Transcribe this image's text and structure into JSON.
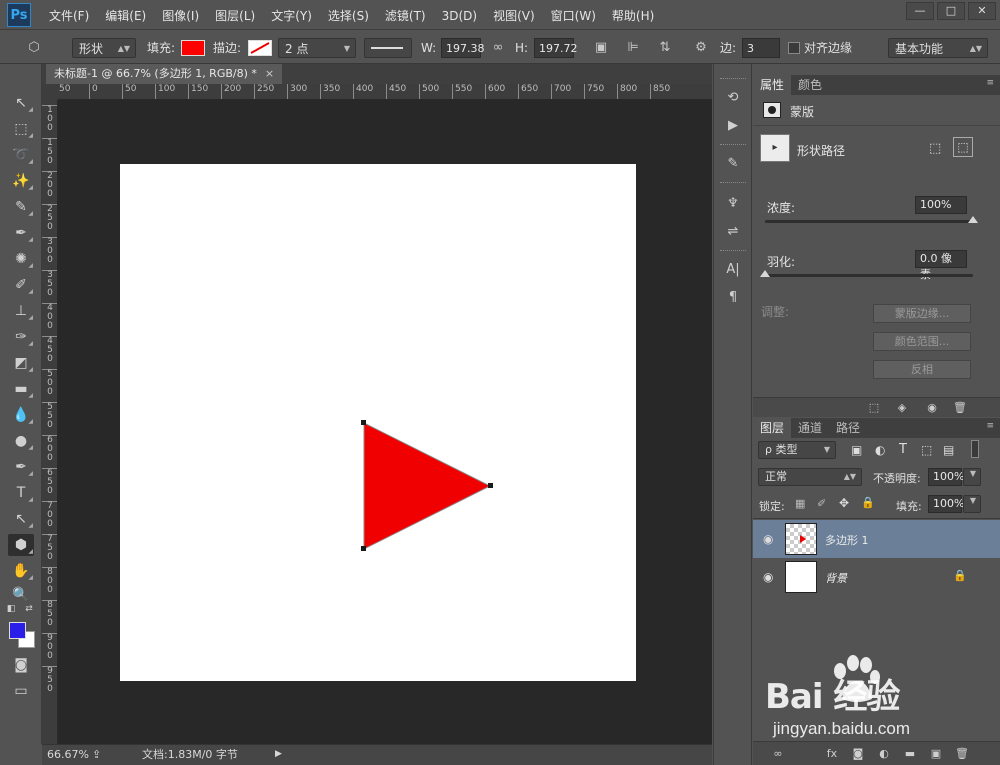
{
  "app": {
    "logo": "Ps"
  },
  "menu": [
    "文件(F)",
    "编辑(E)",
    "图像(I)",
    "图层(L)",
    "文字(Y)",
    "选择(S)",
    "滤镜(T)",
    "3D(D)",
    "视图(V)",
    "窗口(W)",
    "帮助(H)"
  ],
  "window_controls": {
    "minimize": "—",
    "maximize": "□",
    "close": "✕"
  },
  "options": {
    "mode": "形状",
    "fill_label": "填充:",
    "stroke_label": "描边:",
    "stroke_width": "2 点",
    "w_label": "W:",
    "w_value": "197.38",
    "h_label": "H:",
    "h_value": "197.72",
    "sides_label": "边:",
    "sides_value": "3",
    "align_edges": "对齐边缘",
    "workspace": "基本功能",
    "fill_color": "#ff0000"
  },
  "document": {
    "tab_title": "未标题-1 @ 66.7% (多边形 1, RGB/8) *",
    "tab_close": "×",
    "ruler_h": [
      "50",
      "0",
      "50",
      "100",
      "150",
      "200",
      "250",
      "300",
      "350",
      "400",
      "450",
      "500",
      "550",
      "600",
      "650",
      "700",
      "750",
      "800",
      "850"
    ],
    "ruler_v": [
      "1\n0\n0",
      "1\n5\n0",
      "2\n0\n0",
      "2\n5\n0",
      "3\n0\n0",
      "3\n5\n0",
      "4\n0\n0",
      "4\n5\n0",
      "5\n0\n0",
      "5\n5\n0",
      "6\n0\n0",
      "6\n5\n0",
      "7\n0\n0",
      "7\n5\n0",
      "8\n0\n0",
      "8\n5\n0",
      "9\n0\n0",
      "9\n5\n0"
    ],
    "shape_color": "#f00000"
  },
  "status": {
    "zoom": "66.67%",
    "doc_info": "文档:1.83M/0 字节"
  },
  "colors": {
    "foreground": "#2b1ee8",
    "background": "#ffffff"
  },
  "properties": {
    "tabs": [
      "属性",
      "颜色"
    ],
    "mask_label": "蒙版",
    "shape_path_label": "形状路径",
    "density_label": "浓度:",
    "density_value": "100%",
    "density_fraction": 1.0,
    "feather_label": "羽化:",
    "feather_value": "0.0 像素",
    "feather_fraction": 0.0,
    "adjust_label": "调整:",
    "mask_edge_btn": "蒙版边缘...",
    "color_range_btn": "颜色范围...",
    "invert_btn": "反相"
  },
  "layers": {
    "tabs": [
      "图层",
      "通道",
      "路径"
    ],
    "filter_kind": "ρ 类型",
    "blend_mode": "正常",
    "opacity_label": "不透明度:",
    "opacity_value": "100%",
    "lock_label": "锁定:",
    "fill_label": "填充:",
    "fill_value": "100%",
    "items": [
      {
        "name": "多边形 1",
        "selected": true
      },
      {
        "name": "背景",
        "selected": false
      }
    ]
  },
  "watermark": {
    "logo": "Bai 经验",
    "url": "jingyan.baidu.com"
  }
}
